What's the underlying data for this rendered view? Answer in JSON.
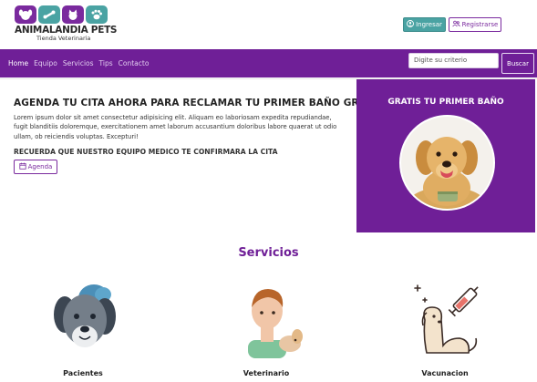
{
  "brand": {
    "name": "ANIMALANDIA PETS",
    "tagline": "Tienda Veterinaria"
  },
  "header": {
    "login_label": "Ingresar",
    "register_label": "Registrarse"
  },
  "nav": {
    "items": [
      {
        "label": "Home",
        "active": true
      },
      {
        "label": "Equipo"
      },
      {
        "label": "Servicios"
      },
      {
        "label": "Tips"
      },
      {
        "label": "Contacto"
      }
    ],
    "search_placeholder": "Digite su criterio",
    "search_button": "Buscar"
  },
  "hero": {
    "title": "AGENDA TU CITA AHORA PARA RECLAMAR TU PRIMER BAÑO GRATIS",
    "body": "Lorem ipsum dolor sit amet consectetur adipisicing elit. Aliquam eo laboriosam expedita repudiandae, fugit blanditiis doloremque, exercitationem amet laborum accusantium doloribus labore quaerat ut odio ullam, ob reiciendis voluptas. Excepturi!",
    "subtitle": "RECUERDA QUE NUESTRO EQUIPO MEDICO TE CONFIRMARA LA CITA",
    "agenda_label": "Agenda"
  },
  "promo": {
    "title": "GRATIS TU PRIMER BAÑO"
  },
  "services": {
    "title": "Servicios",
    "items": [
      {
        "label": "Pacientes"
      },
      {
        "label": "Veterinario"
      },
      {
        "label": "Vacunacion"
      }
    ]
  },
  "colors": {
    "brand_purple": "#6f1f97",
    "teal": "#4aa3a3"
  }
}
